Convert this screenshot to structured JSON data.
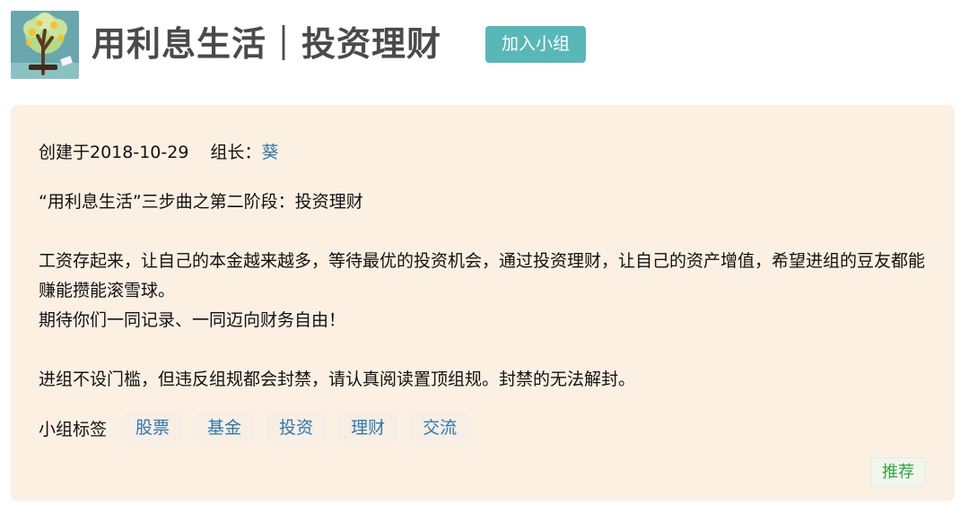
{
  "header": {
    "title": "用利息生活｜投资理财",
    "join_label": "加入小组",
    "logo_icon": "money-tree-icon"
  },
  "info": {
    "created": "创建于2018-10-29",
    "owner_label": "组长：",
    "owner_name": "葵"
  },
  "intro": {
    "paragraphs": [
      "“用利息生活”三步曲之第二阶段：投资理财",
      "",
      "工资存起来，让自己的本金越来越多，等待最优的投资机会，通过投资理财，让自己的资产增值，希望进组的豆友都能赚能攒能滚雪球。",
      "期待你们一同记录、一同迈向财务自由！",
      "",
      "进组不设门槛，但违反组规都会封禁，请认真阅读置顶组规。封禁的无法解封。"
    ]
  },
  "tags": {
    "label": "小组标签",
    "items": [
      "股票",
      "基金",
      "投资",
      "理财",
      "交流"
    ]
  },
  "actions": {
    "recommend_label": "推荐"
  },
  "colors": {
    "accent": "#59b7b8",
    "card_background": "#fcf0e3",
    "link": "#3377aa",
    "recommend": "#37a246"
  }
}
